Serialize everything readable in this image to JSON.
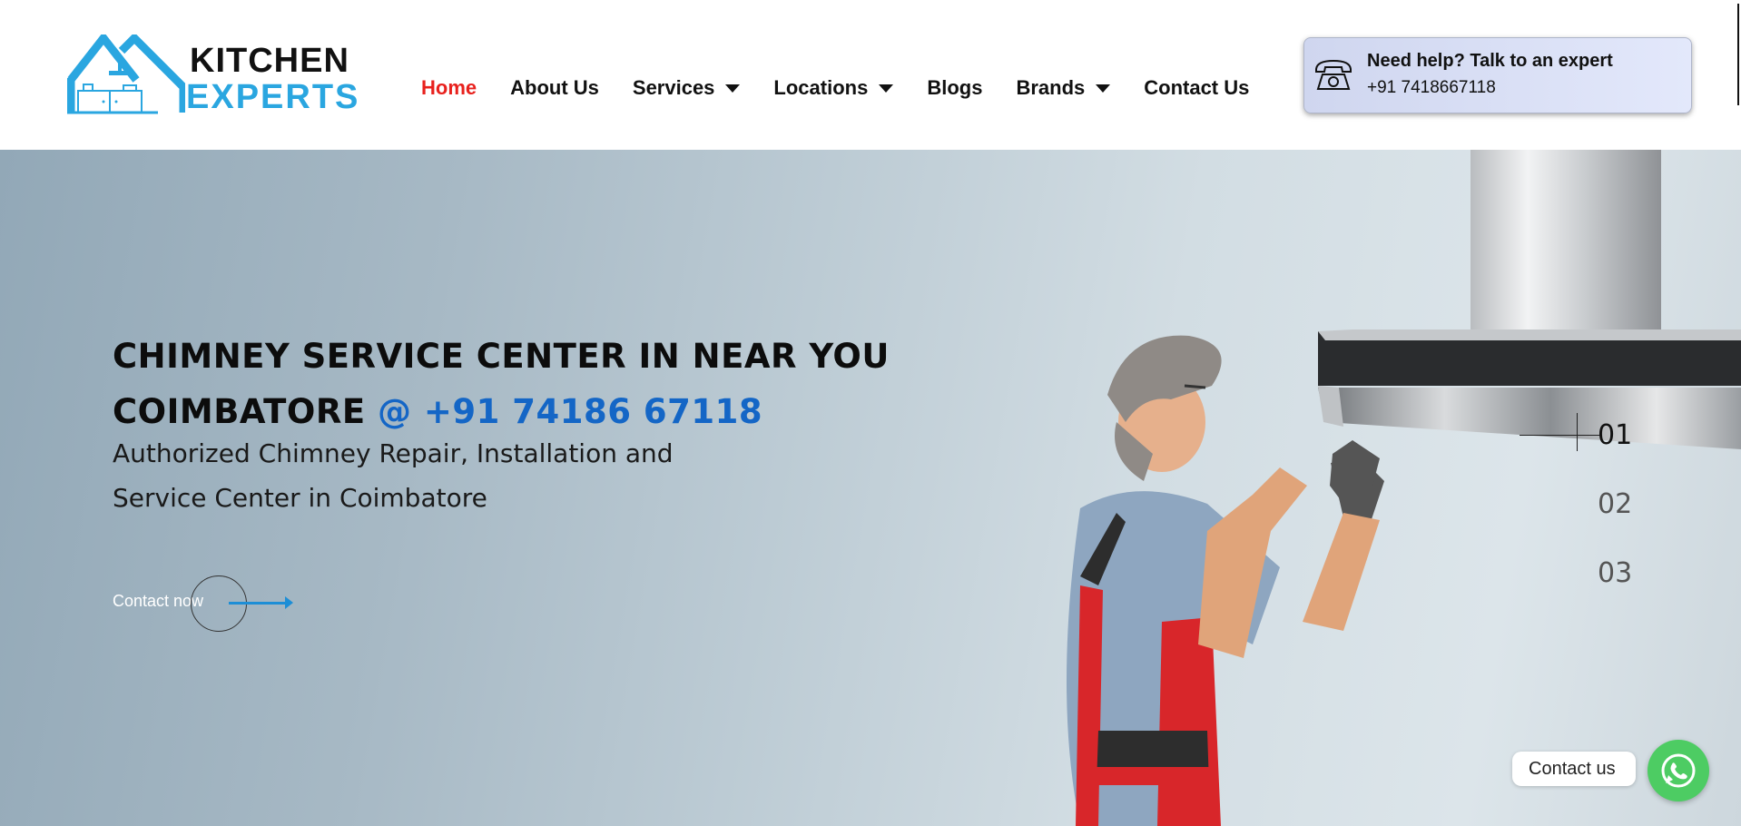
{
  "brand": {
    "line1": "KITCHEN",
    "line2": "EXPERTS"
  },
  "nav": {
    "items": [
      {
        "label": "Home",
        "active": true,
        "dropdown": false
      },
      {
        "label": "About Us",
        "dropdown": false
      },
      {
        "label": "Services",
        "dropdown": true
      },
      {
        "label": "Locations",
        "dropdown": true
      },
      {
        "label": "Blogs",
        "dropdown": false
      },
      {
        "label": "Brands",
        "dropdown": true
      },
      {
        "label": "Contact Us",
        "dropdown": false
      }
    ]
  },
  "help": {
    "title": "Need help? Talk to an expert",
    "phone": "+91 7418667118"
  },
  "hero": {
    "title_line1": "CHIMNEY SERVICE CENTER IN NEAR YOU",
    "title_line2": "COIMBATORE ",
    "title_phone": "@ +91 74186 67118",
    "subtitle": "Authorized Chimney Repair, Installation and Service Center in Coimbatore",
    "cta": "Contact now"
  },
  "slider": {
    "numbers": [
      "01",
      "02",
      "03"
    ],
    "active": 0
  },
  "whatsapp": {
    "label": "Contact us"
  },
  "colors": {
    "accent_red": "#e8211d",
    "brand_blue": "#2aa6e0",
    "phone_blue": "#1466c6",
    "whatsapp_green": "#4dcc63"
  }
}
